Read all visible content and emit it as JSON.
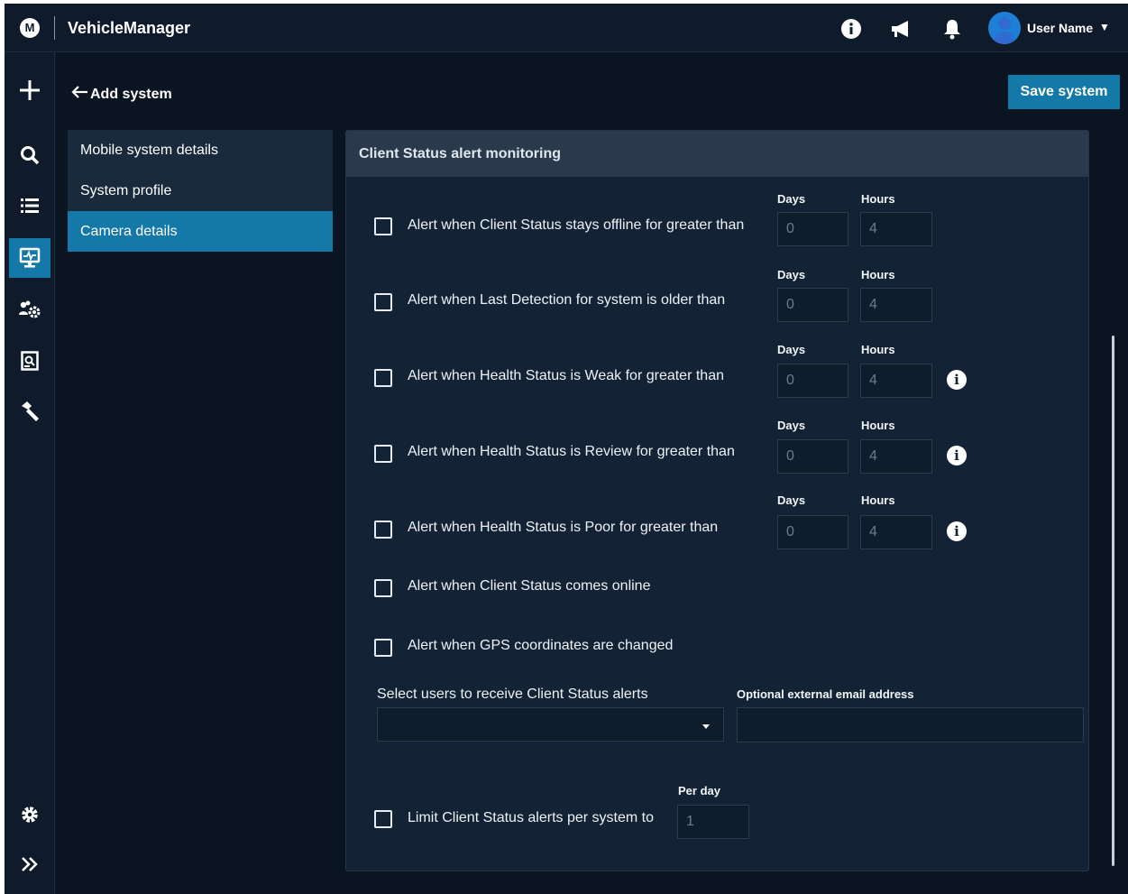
{
  "header": {
    "logo": "M",
    "app_title": "VehicleManager",
    "user_name": "User Name"
  },
  "sidenav": {
    "items": [
      "plus-icon",
      "search-icon",
      "list-icon",
      "monitor-icon",
      "users-gear-icon",
      "report-icon",
      "hammer-icon"
    ],
    "bottom_items": [
      "gear-icon",
      "expand-icon"
    ]
  },
  "page": {
    "back_label": "Add system",
    "save_label": "Save system"
  },
  "subnav": {
    "items": [
      {
        "label": "Mobile system details"
      },
      {
        "label": "System profile"
      },
      {
        "label": "Camera details"
      }
    ]
  },
  "panel": {
    "title": "Client Status alert monitoring",
    "threshold_rows": [
      {
        "label": "Alert when Client Status stays offline for greater than",
        "days_label": "Days",
        "hours_label": "Hours",
        "days_value": "0",
        "hours_value": "4"
      },
      {
        "label": "Alert when Last Detection for system is older than",
        "days_label": "Days",
        "hours_label": "Hours",
        "days_value": "0",
        "hours_value": "4"
      },
      {
        "label": "Alert when Health Status is Weak for greater than",
        "days_label": "Days",
        "hours_label": "Hours",
        "days_value": "0",
        "hours_value": "4"
      },
      {
        "label": "Alert when Health Status is Review for greater than",
        "days_label": "Days",
        "hours_label": "Hours",
        "days_value": "0",
        "hours_value": "4"
      },
      {
        "label": "Alert when Health Status is Poor for greater than",
        "days_label": "Days",
        "hours_label": "Hours",
        "days_value": "0",
        "hours_value": "4"
      }
    ],
    "simple_rows": [
      {
        "label": "Alert when Client Status comes online"
      },
      {
        "label": "Alert when GPS coordinates are changed"
      }
    ],
    "users_select_label": "Select users to receive Client Status alerts",
    "users_select_value": "",
    "email_label": "Optional external email address",
    "email_value": "",
    "limit_label": "Limit Client Status alerts per system to",
    "per_day_label": "Per day",
    "per_day_value": "1"
  },
  "colors": {
    "background": "#0b1522",
    "accent": "#1478a8",
    "panel": "#132234"
  }
}
